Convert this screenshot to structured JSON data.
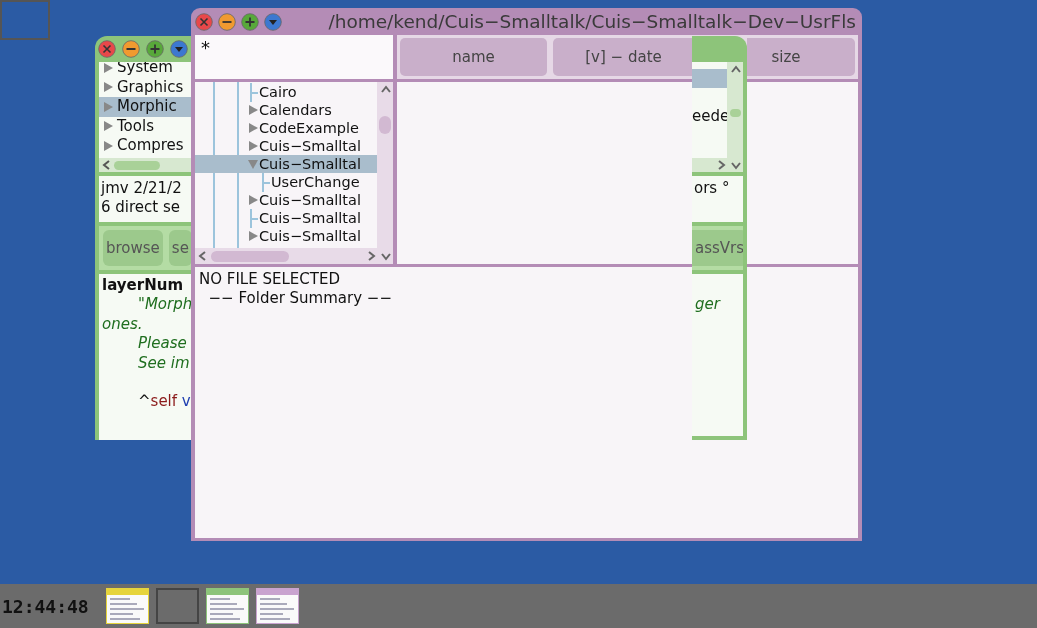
{
  "back_window": {
    "left_part": {
      "categories": [
        {
          "label": "System",
          "selected": false
        },
        {
          "label": "Graphics",
          "selected": false
        },
        {
          "label": "Morphic",
          "selected": true
        },
        {
          "label": "Tools",
          "selected": false
        },
        {
          "label": "Compres",
          "selected": false
        }
      ],
      "info_lines": [
        "jmv 2/21/2",
        "6 direct se"
      ],
      "buttons": [
        "browse",
        "se"
      ],
      "code_lines": [
        {
          "kind": "selector",
          "text": "layerNum"
        },
        {
          "kind": "comment",
          "text": "\"Morph"
        },
        {
          "kind": "comment_wrap",
          "text": "ones."
        },
        {
          "kind": "comment",
          "text": "Please"
        },
        {
          "kind": "comment",
          "text": "See im"
        },
        {
          "kind": "blank"
        },
        {
          "kind": "code",
          "segments": [
            {
              "kind": "plain",
              "text": "^"
            },
            {
              "kind": "pseudo",
              "text": "self "
            },
            {
              "kind": "message",
              "text": "v"
            }
          ]
        }
      ]
    },
    "right_part": {
      "top_row_selected": true,
      "list_text": "eede",
      "info_text": "ors °",
      "button": "assVrs",
      "code_text": "ger"
    }
  },
  "file_window": {
    "title": "/home/kend/Cuis−Smalltalk/Cuis−Smalltalk−Dev−UsrFls",
    "filter": "*",
    "columns": [
      {
        "label": "name"
      },
      {
        "label": "[v] − date"
      },
      {
        "label": "size"
      }
    ],
    "tree": [
      {
        "label": "Cairo",
        "kind": "leaf",
        "selected": false
      },
      {
        "label": "Calendars",
        "kind": "folder",
        "expanded": false,
        "selected": false
      },
      {
        "label": "CodeExample",
        "kind": "folder",
        "expanded": false,
        "selected": false
      },
      {
        "label": "Cuis−Smalltal",
        "kind": "folder",
        "expanded": false,
        "selected": false
      },
      {
        "label": "Cuis−Smalltal",
        "kind": "folder",
        "expanded": true,
        "selected": true,
        "children": [
          {
            "label": "UserChange",
            "kind": "leaf",
            "selected": false
          }
        ]
      },
      {
        "label": "Cuis−Smalltal",
        "kind": "folder",
        "expanded": false,
        "selected": false
      },
      {
        "label": "Cuis−Smalltal",
        "kind": "leaf",
        "selected": false
      },
      {
        "label": "Cuis−Smalltal",
        "kind": "folder",
        "expanded": false,
        "selected": false
      }
    ],
    "summary_lines": [
      "NO FILE SELECTED",
      "  −− Folder Summary −−"
    ]
  },
  "taskbar": {
    "clock": "12:44:48",
    "thumbnails": [
      {
        "kind": "window",
        "color": "#e6d43c"
      },
      {
        "kind": "empty"
      },
      {
        "kind": "window",
        "color": "#8dc47a"
      },
      {
        "kind": "window",
        "color": "#c9a3cf"
      }
    ]
  }
}
